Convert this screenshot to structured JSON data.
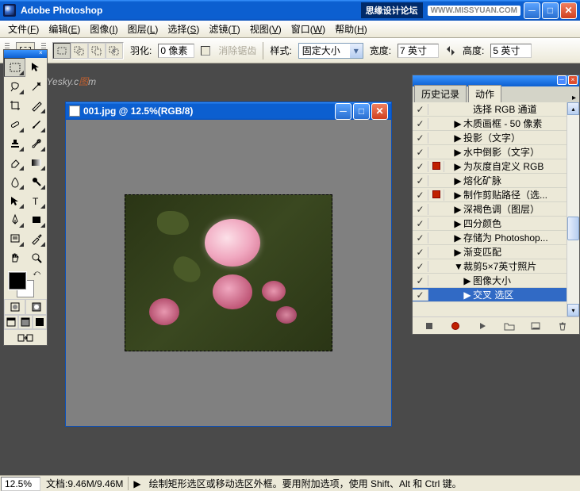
{
  "app": {
    "title": "Adobe Photoshop",
    "badge_text": "思缘设计论坛",
    "url_badge": "WWW.MISSYUAN.COM"
  },
  "menubar": [
    {
      "label": "文件",
      "key": "F"
    },
    {
      "label": "编辑",
      "key": "E"
    },
    {
      "label": "图像",
      "key": "I"
    },
    {
      "label": "图层",
      "key": "L"
    },
    {
      "label": "选择",
      "key": "S"
    },
    {
      "label": "滤镜",
      "key": "T"
    },
    {
      "label": "视图",
      "key": "V"
    },
    {
      "label": "窗口",
      "key": "W"
    },
    {
      "label": "帮助",
      "key": "H"
    }
  ],
  "options": {
    "feather_label": "羽化:",
    "feather_value": "0 像素",
    "antialias_label": "消除锯齿",
    "style_label": "样式:",
    "style_value": "固定大小",
    "width_label": "宽度:",
    "width_value": "7 英寸",
    "height_label": "高度:",
    "height_value": "5 英寸"
  },
  "watermark": "Soft.Yesky.c",
  "watermark_o": "图",
  "watermark_tail": "m",
  "document": {
    "title": "001.jpg @ 12.5%(RGB/8)"
  },
  "actions_panel": {
    "tabs": [
      "历史记录",
      "动作"
    ],
    "active_tab": 1,
    "items": [
      {
        "check": true,
        "dialog": false,
        "indent": 2,
        "expand": "",
        "label": "选择 RGB 通道"
      },
      {
        "check": true,
        "dialog": false,
        "indent": 1,
        "expand": "▶",
        "label": "木质画框 - 50 像素"
      },
      {
        "check": true,
        "dialog": false,
        "indent": 1,
        "expand": "▶",
        "label": "投影（文字）"
      },
      {
        "check": true,
        "dialog": false,
        "indent": 1,
        "expand": "▶",
        "label": "水中倒影（文字）"
      },
      {
        "check": true,
        "dialog": true,
        "indent": 1,
        "expand": "▶",
        "label": "为灰度自定义 RGB"
      },
      {
        "check": true,
        "dialog": false,
        "indent": 1,
        "expand": "▶",
        "label": "熔化矿脉"
      },
      {
        "check": true,
        "dialog": true,
        "indent": 1,
        "expand": "▶",
        "label": "制作剪贴路径（选..."
      },
      {
        "check": true,
        "dialog": false,
        "indent": 1,
        "expand": "▶",
        "label": "深褐色调（图层）"
      },
      {
        "check": true,
        "dialog": false,
        "indent": 1,
        "expand": "▶",
        "label": "四分颜色"
      },
      {
        "check": true,
        "dialog": false,
        "indent": 1,
        "expand": "▶",
        "label": "存储为 Photoshop..."
      },
      {
        "check": true,
        "dialog": false,
        "indent": 1,
        "expand": "▶",
        "label": "渐变匹配"
      },
      {
        "check": true,
        "dialog": false,
        "indent": 1,
        "expand": "▼",
        "label": "裁剪5×7英寸照片"
      },
      {
        "check": true,
        "dialog": false,
        "indent": 2,
        "expand": "▶",
        "label": "图像大小"
      },
      {
        "check": true,
        "dialog": false,
        "indent": 2,
        "expand": "▶",
        "label": "交叉 选区",
        "selected": true
      }
    ]
  },
  "status": {
    "zoom": "12.5%",
    "doc_info": "文档:9.46M/9.46M",
    "hint": "绘制矩形选区或移动选区外框。要用附加选项，使用 Shift、Alt 和 Ctrl 键。"
  }
}
